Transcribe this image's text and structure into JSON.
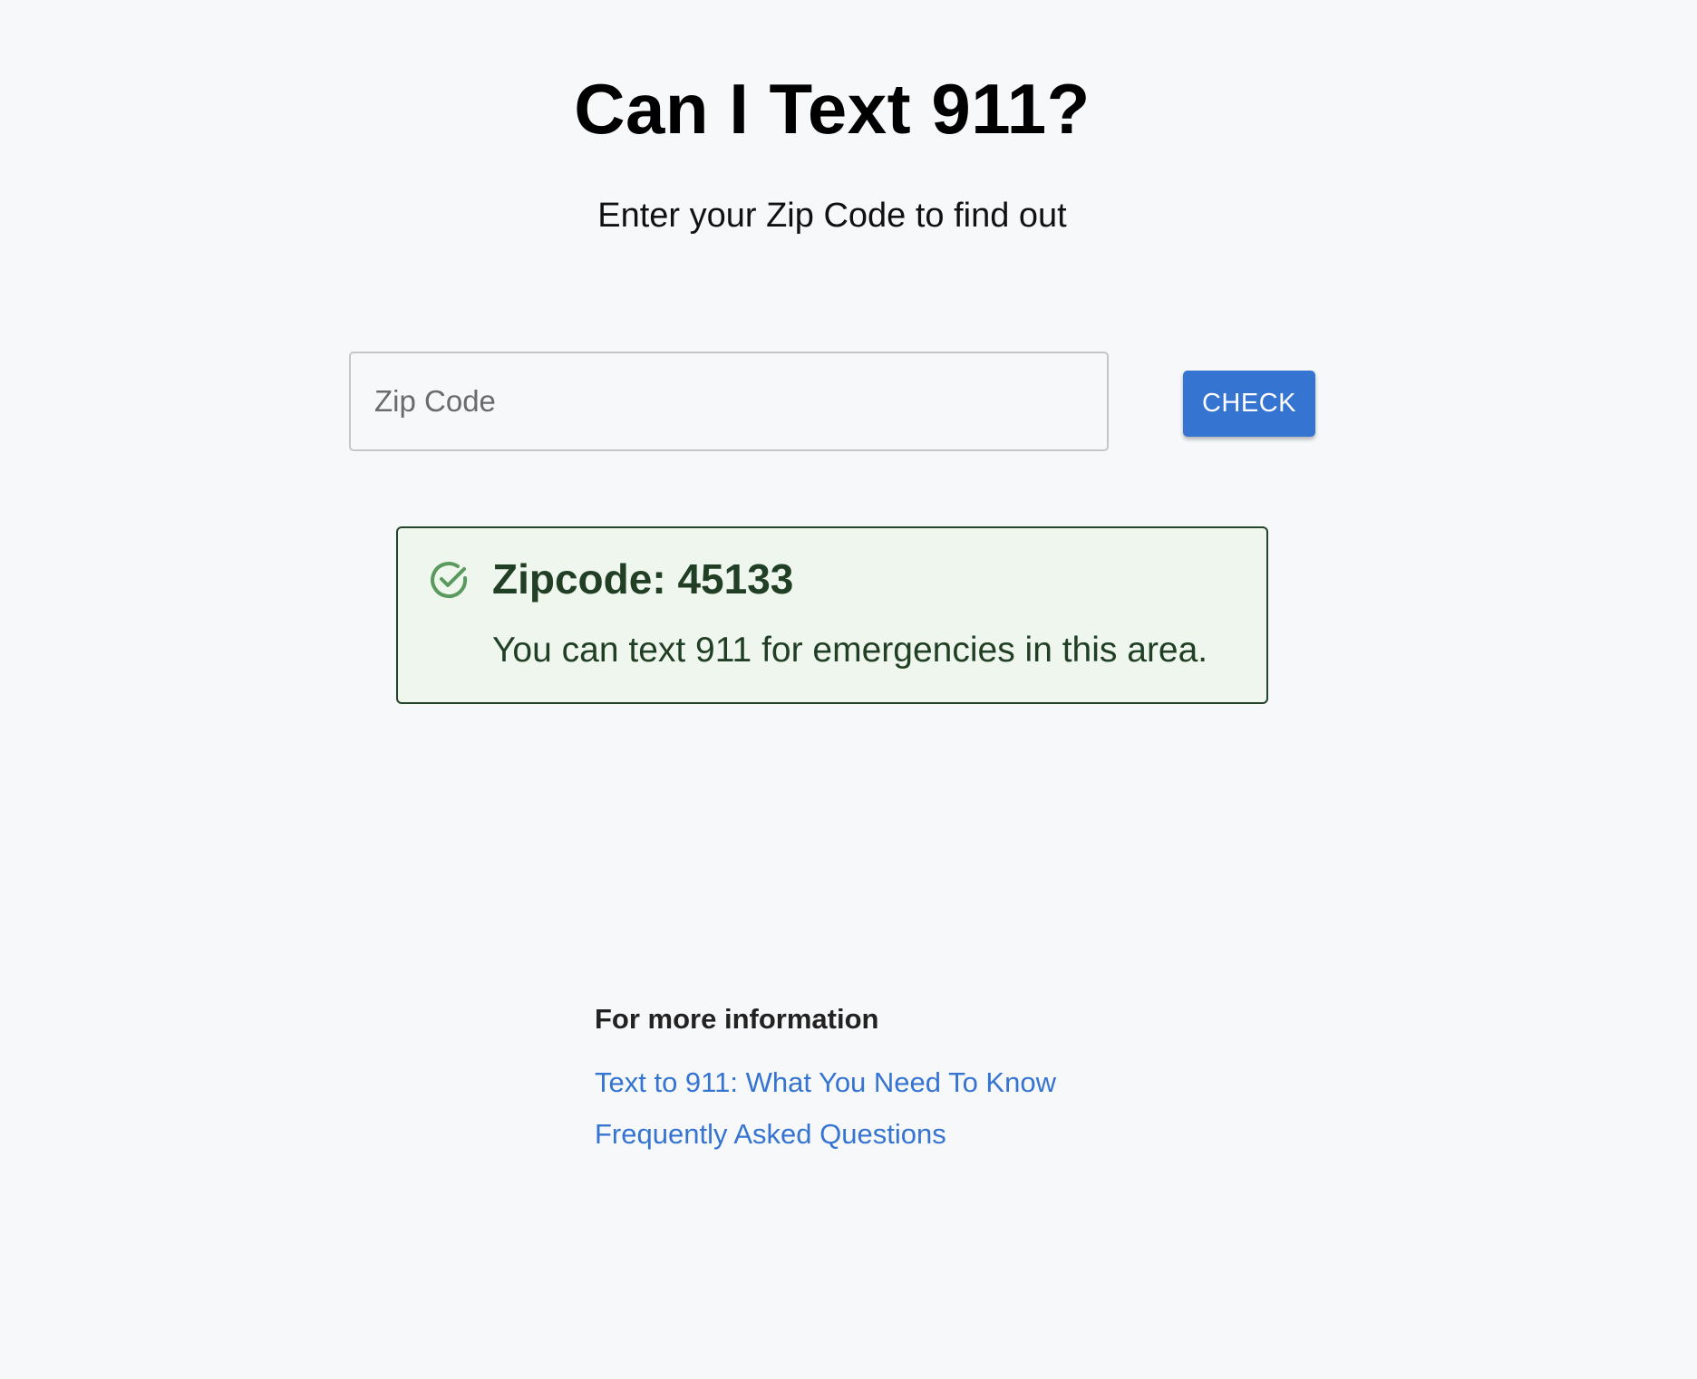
{
  "page": {
    "title": "Can I Text 911?",
    "subtitle": "Enter your Zip Code to find out"
  },
  "search": {
    "placeholder": "Zip Code",
    "value": "",
    "button_label": "CHECK"
  },
  "result": {
    "status_icon": "check-circle-icon",
    "heading": "Zipcode: 45133",
    "message": "You can text 911 for emergencies in this area."
  },
  "more_info": {
    "heading": "For more information",
    "links": [
      {
        "label": "Text to 911: What You Need To Know"
      },
      {
        "label": "Frequently Asked Questions"
      }
    ]
  },
  "colors": {
    "background": "#f7f8fa",
    "accent": "#3674d2",
    "success_border": "#25452a",
    "success_background": "#eff6ee",
    "success_text": "#213f24",
    "success_icon": "#5a9a5e"
  }
}
